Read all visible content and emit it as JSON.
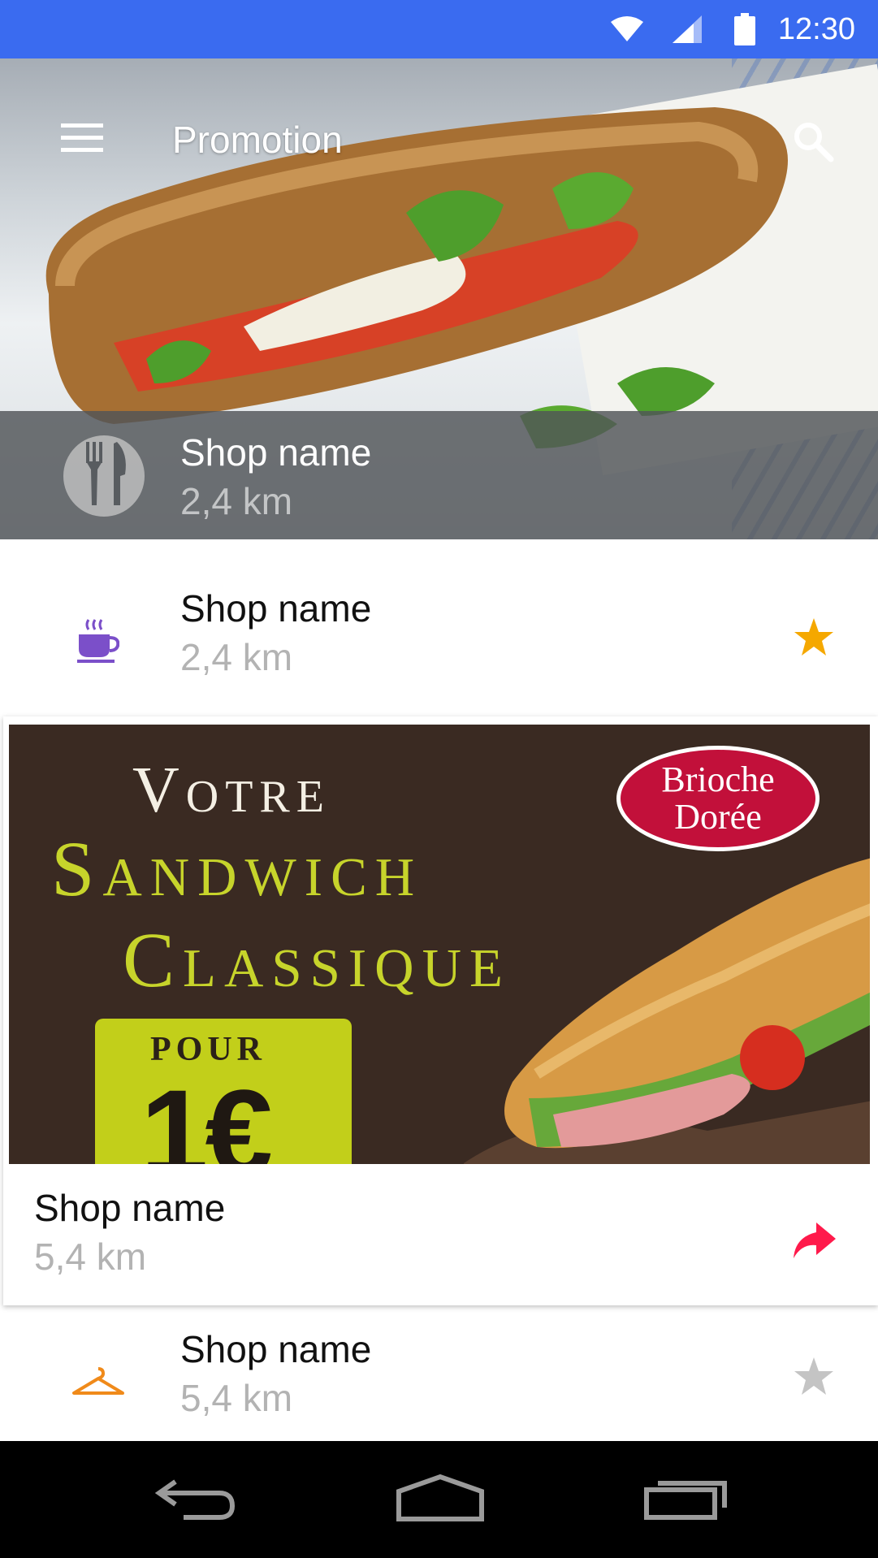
{
  "status_bar": {
    "time": "12:30",
    "icons": [
      "wifi-icon",
      "signal-icon",
      "battery-icon"
    ],
    "background": "#3a6bf0"
  },
  "toolbar": {
    "title": "Promotion",
    "menu_icon": "menu-icon",
    "search_icon": "search-icon"
  },
  "featured": {
    "name": "Shop name",
    "distance": "2,4 km",
    "icon": "fork-knife-icon"
  },
  "list": [
    {
      "name": "Shop name",
      "distance": "2,4 km",
      "icon": "coffee-cup-icon",
      "icon_color": "#7b4fc9",
      "action_icon": "star-icon",
      "starred": true,
      "action_color": "#f5a800"
    }
  ],
  "promo": {
    "banner": {
      "line1": "Votre",
      "line2": "Sandwich",
      "line3": "Classique",
      "price_prefix": "POUR",
      "price": "1€",
      "brand_line1": "Brioche",
      "brand_line2": "Dorée"
    },
    "name": "Shop name",
    "distance": "5,4 km",
    "action_icon": "share-arrow-icon",
    "action_color": "#ff1a4b"
  },
  "list_bottom": [
    {
      "name": "Shop name",
      "distance": "5,4 km",
      "icon": "hanger-icon",
      "icon_color": "#f08a1a",
      "action_icon": "star-icon",
      "starred": false,
      "action_color": "#c4c4c4"
    }
  ],
  "nav": {
    "buttons": [
      "back-icon",
      "home-icon",
      "recents-icon"
    ]
  }
}
